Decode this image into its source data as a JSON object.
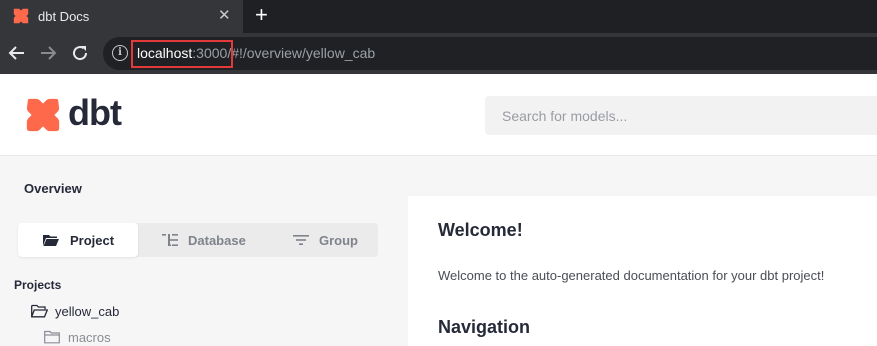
{
  "browser": {
    "tab_title": "dbt Docs",
    "tab_close": "✕",
    "new_tab": "+",
    "url_host": "localhost",
    "url_port": ":3000",
    "url_path": "/#!/overview/yellow_cab",
    "info_glyph": "i"
  },
  "header": {
    "wordmark": "dbt",
    "search_placeholder": "Search for models..."
  },
  "sidebar": {
    "overview_label": "Overview",
    "tabs": [
      {
        "label": "Project",
        "active": true
      },
      {
        "label": "Database",
        "active": false
      },
      {
        "label": "Group",
        "active": false
      }
    ],
    "projects_label": "Projects",
    "tree": [
      {
        "label": "yellow_cab",
        "icon": "folder-open-icon"
      },
      {
        "label": "macros",
        "icon": "folder-icon"
      }
    ]
  },
  "main": {
    "welcome_title": "Welcome!",
    "welcome_text": "Welcome to the auto-generated documentation for your dbt project!",
    "navigation_title": "Navigation"
  },
  "colors": {
    "brand": "#ff694b",
    "highlight": "#e23a3a",
    "text": "#262a38"
  }
}
